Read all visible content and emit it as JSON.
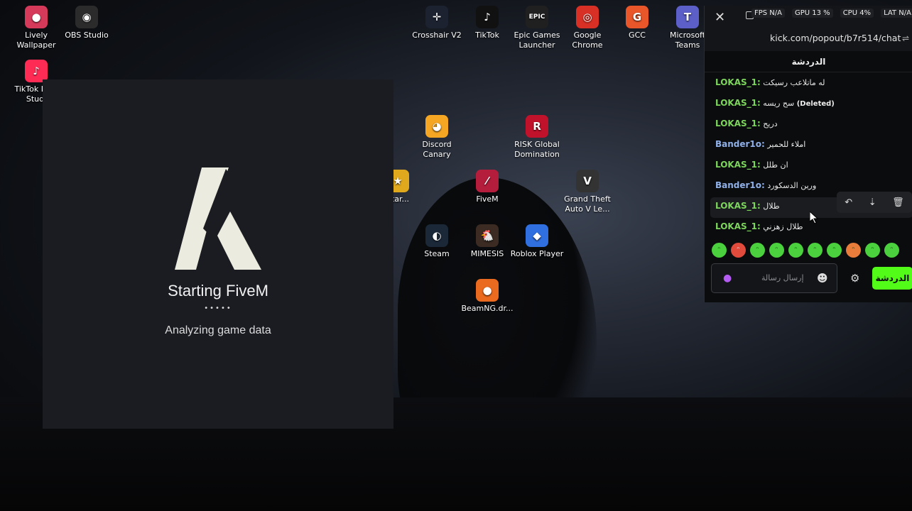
{
  "desktop": {
    "icons": [
      {
        "label": "Lively Wallpaper",
        "glyph": "●",
        "color": "#d63a5a"
      },
      {
        "label": "OBS Studio",
        "glyph": "◉",
        "color": "#2b2b2b"
      },
      {
        "label": "TikTok LIVE Studi",
        "glyph": "♪",
        "color": "#fe2c55"
      },
      {
        "label": "Crosshair V2",
        "glyph": "✛",
        "color": "#1c2230"
      },
      {
        "label": "TikTok",
        "glyph": "♪",
        "color": "#111111"
      },
      {
        "label": "Epic Games Launcher",
        "glyph": "EPIC",
        "color": "#202020"
      },
      {
        "label": "Google Chrome",
        "glyph": "◎",
        "color": "#d93025"
      },
      {
        "label": "GCC",
        "glyph": "G",
        "color": "#e8562a"
      },
      {
        "label": "Microsoft Teams",
        "glyph": "T",
        "color": "#5b5fc7"
      },
      {
        "label": "Discord Canary",
        "glyph": "◕",
        "color": "#f5a623"
      },
      {
        "label": "RISK Global Domination",
        "glyph": "R",
        "color": "#c0122b"
      },
      {
        "label": "Star...",
        "glyph": "★",
        "color": "#e0a81c"
      },
      {
        "label": "FiveM",
        "glyph": "⁄",
        "color": "#b51d3c"
      },
      {
        "label": "Grand Theft Auto V Le...",
        "glyph": "V",
        "color": "#333333"
      },
      {
        "label": "Steam",
        "glyph": "◐",
        "color": "#1b2838"
      },
      {
        "label": "MIMESIS",
        "glyph": "🐔",
        "color": "#3b2b22"
      },
      {
        "label": "Roblox Player",
        "glyph": "◆",
        "color": "#2f6fe0"
      },
      {
        "label": "BeamNG.dr...",
        "glyph": "●",
        "color": "#ea6a1f"
      }
    ]
  },
  "fivem": {
    "title": "Starting FiveM",
    "dots": "•••••",
    "status": "Analyzing game data"
  },
  "chat": {
    "stats": {
      "fps": "FPS N/A",
      "gpu": "GPU 13 %",
      "cpu": "CPU 4%",
      "lat": "LAT N/A"
    },
    "url_top": "kick.com/popout/b7r514/ch...",
    "url": "kick.com/popout/b7r514/chat",
    "title": "الدردشة",
    "messages": [
      {
        "user": "LOKAS_1:",
        "user_color": "#7cd65c",
        "text": "له ماتلاعب رسيكت",
        "tag": ""
      },
      {
        "user": "LOKAS_1:",
        "user_color": "#7cd65c",
        "text": "سح ريسه",
        "tag": "(Deleted)"
      },
      {
        "user": "LOKAS_1:",
        "user_color": "#7cd65c",
        "text": "دريح",
        "tag": ""
      },
      {
        "user": "Bander1o:",
        "user_color": "#8fb0e8",
        "text": "املاء للحمير",
        "tag": ""
      },
      {
        "user": "LOKAS_1:",
        "user_color": "#7cd65c",
        "text": "ان طلل",
        "tag": ""
      },
      {
        "user": "Bander1o:",
        "user_color": "#8fb0e8",
        "text": "ورين الدسكورد",
        "tag": ""
      },
      {
        "user": "LOKAS_1:",
        "user_color": "#7cd65c",
        "text": "طلال",
        "tag": ""
      },
      {
        "user": "LOKAS_1:",
        "user_color": "#7cd65c",
        "text": "طلال زهزني",
        "tag": ""
      }
    ],
    "input_placeholder": "إرسال رسالة",
    "send_label": "الدردشة"
  }
}
